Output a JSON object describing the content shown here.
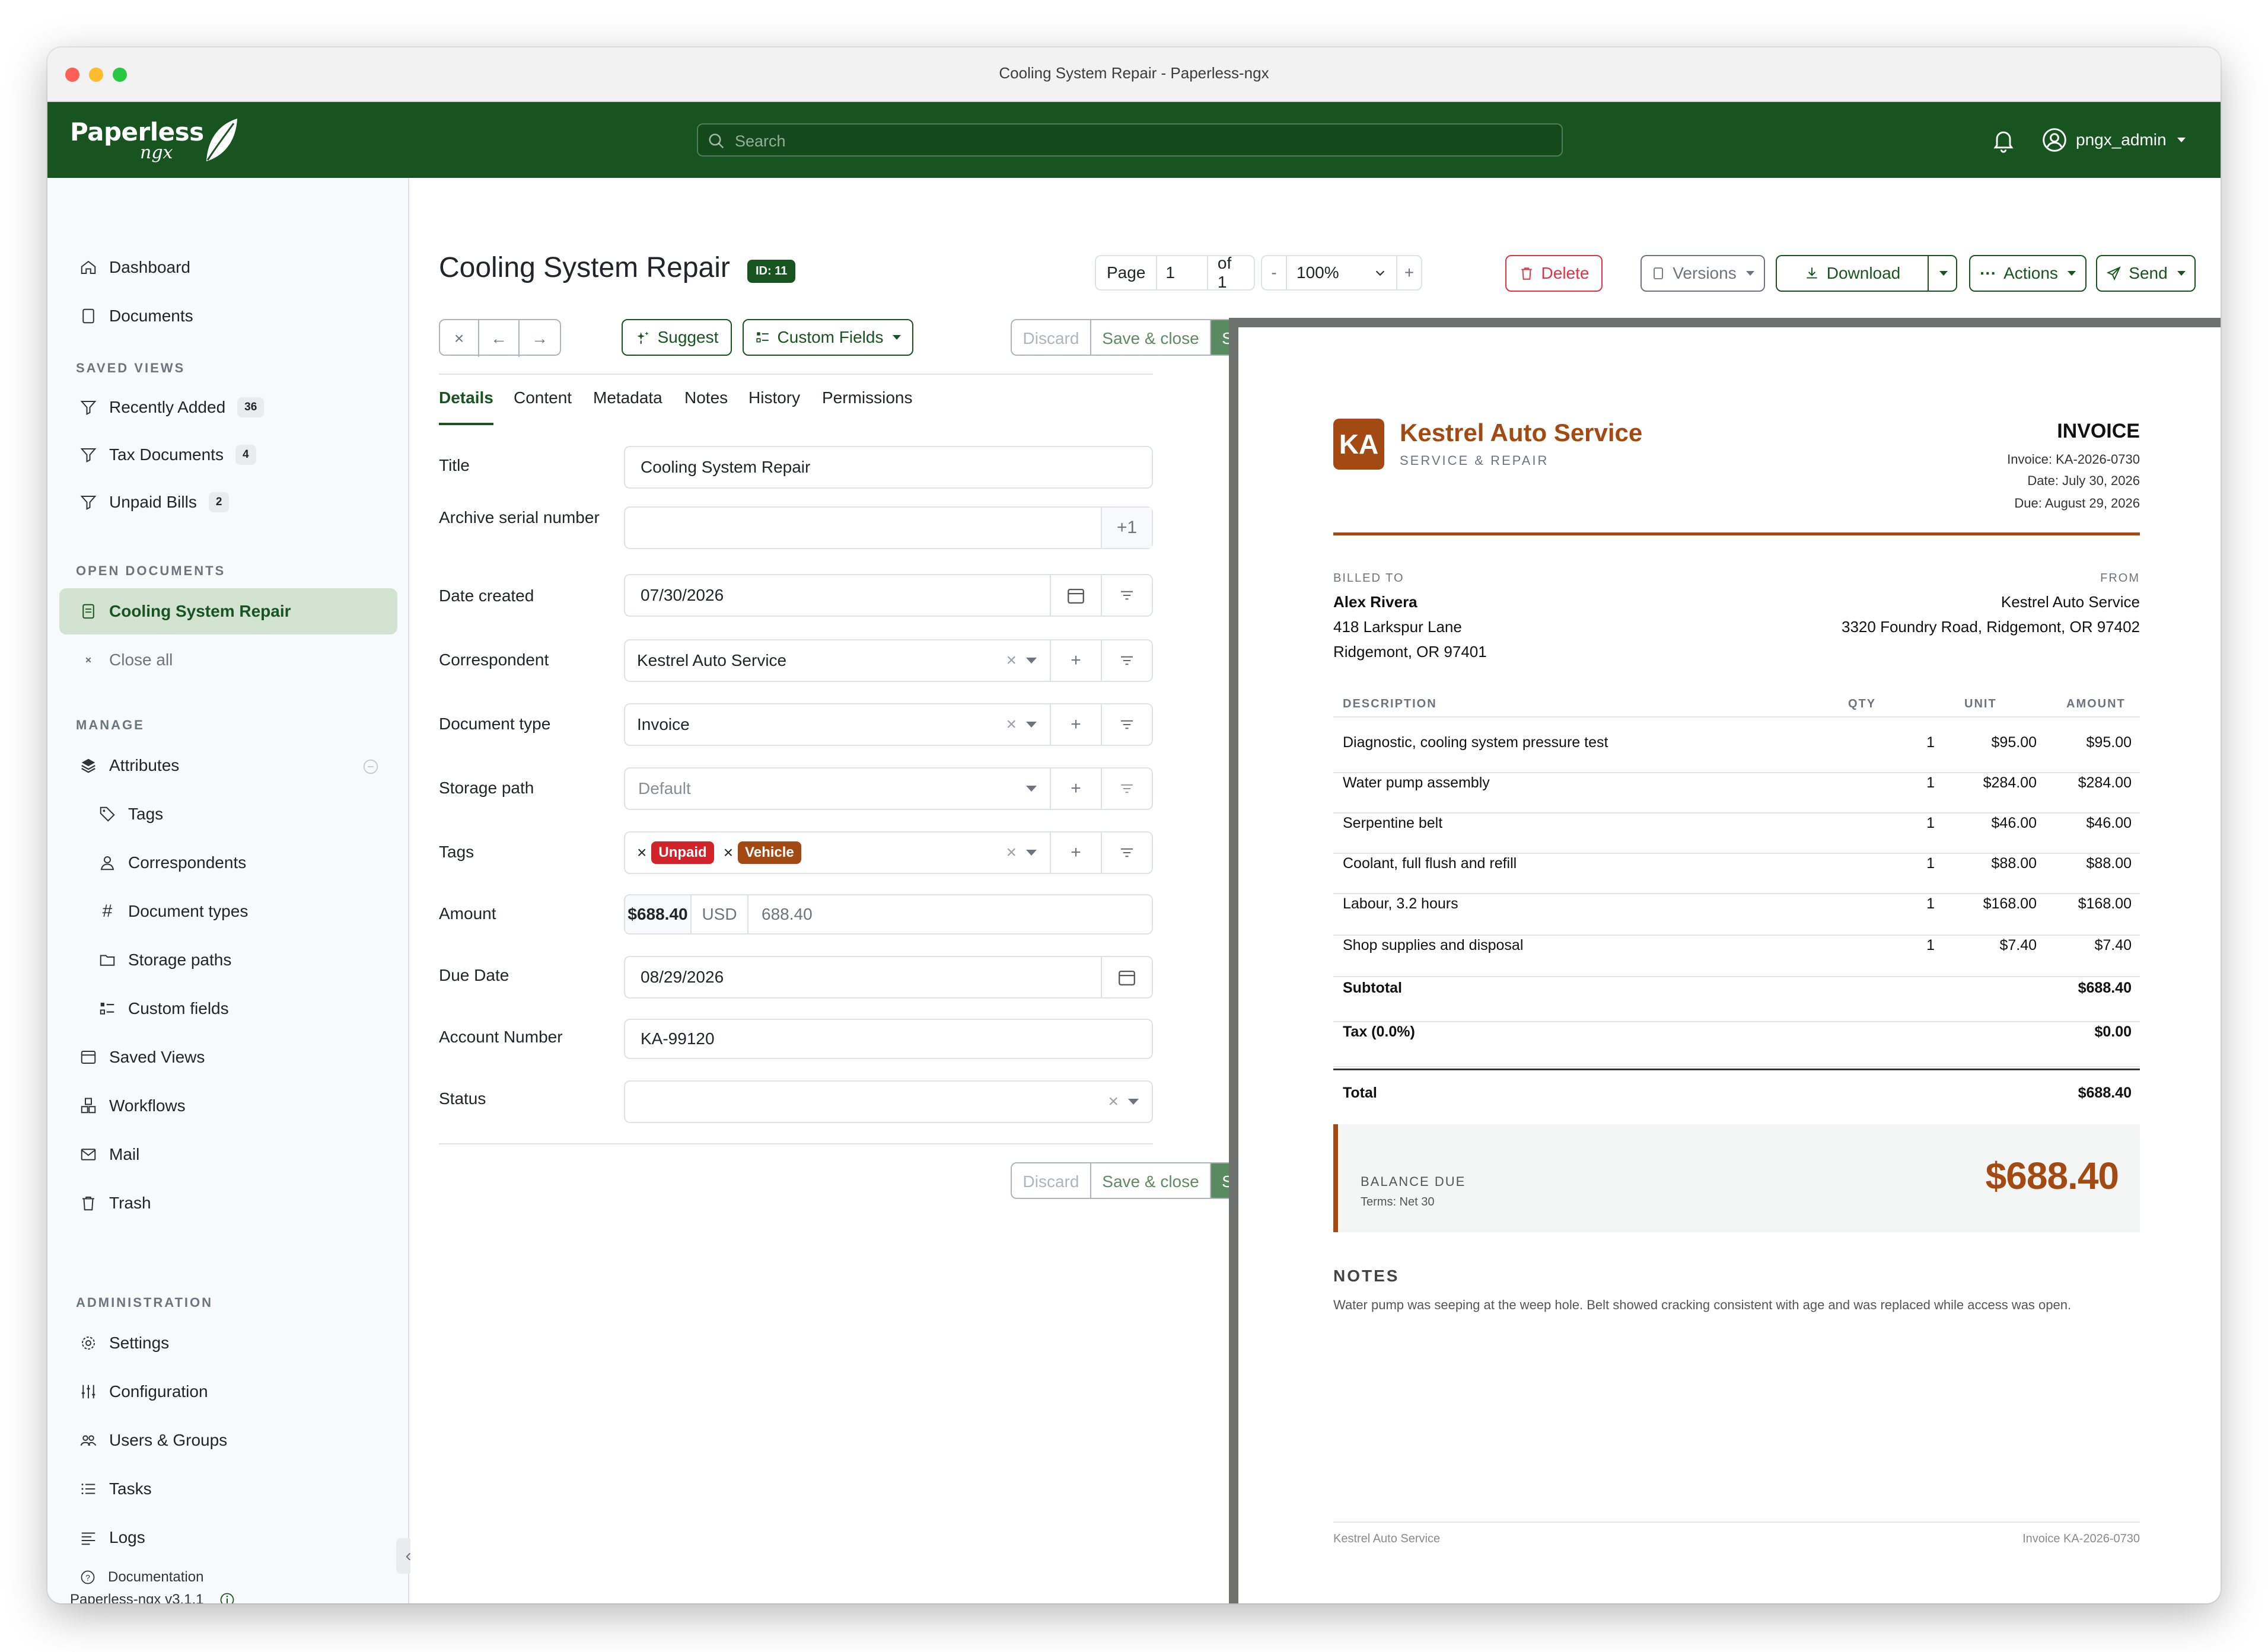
{
  "window": {
    "title": "Cooling System Repair - Paperless-ngx"
  },
  "brand": {
    "name": "Paperless",
    "sub": "ngx"
  },
  "search": {
    "placeholder": "Search"
  },
  "user": {
    "name": "pngx_admin"
  },
  "sidebar": {
    "dashboard": "Dashboard",
    "documents": "Documents",
    "saved_views_header": "SAVED VIEWS",
    "saved_views": [
      {
        "label": "Recently Added",
        "count": "36"
      },
      {
        "label": "Tax Documents",
        "count": "4"
      },
      {
        "label": "Unpaid Bills",
        "count": "2"
      }
    ],
    "open_documents_header": "OPEN DOCUMENTS",
    "open_document": "Cooling System Repair",
    "close_all": "Close all",
    "manage_header": "MANAGE",
    "attributes": "Attributes",
    "attribute_items": [
      "Tags",
      "Correspondents",
      "Document types",
      "Storage paths",
      "Custom fields"
    ],
    "saved_views_link": "Saved Views",
    "workflows": "Workflows",
    "mail": "Mail",
    "trash": "Trash",
    "admin_header": "ADMINISTRATION",
    "settings": "Settings",
    "configuration": "Configuration",
    "users_groups": "Users & Groups",
    "tasks": "Tasks",
    "logs": "Logs",
    "documentation": "Documentation",
    "version": "Paperless-ngx v3.1.1"
  },
  "document": {
    "title": "Cooling System Repair",
    "id_badge": "ID: 11"
  },
  "pager": {
    "page_label": "Page",
    "page": "1",
    "of": "of 1",
    "minus": "-",
    "zoom": "100%",
    "plus": "+"
  },
  "header_actions": {
    "delete": "Delete",
    "versions": "Versions",
    "download": "Download",
    "actions": "Actions",
    "send": "Send"
  },
  "toolbar": {
    "suggest": "Suggest",
    "custom_fields": "Custom Fields",
    "discard": "Discard",
    "save_close": "Save & close",
    "save": "Save"
  },
  "tabs": [
    "Details",
    "Content",
    "Metadata",
    "Notes",
    "History",
    "Permissions"
  ],
  "fields": {
    "title": {
      "label": "Title",
      "value": "Cooling System Repair"
    },
    "asn": {
      "label": "Archive serial number",
      "plus": "+1"
    },
    "date_created": {
      "label": "Date created",
      "value": "07/30/2026"
    },
    "correspondent": {
      "label": "Correspondent",
      "value": "Kestrel Auto Service"
    },
    "document_type": {
      "label": "Document type",
      "value": "Invoice"
    },
    "storage_path": {
      "label": "Storage path",
      "placeholder": "Default"
    },
    "tags": {
      "label": "Tags",
      "items": [
        {
          "name": "Unpaid",
          "color": "#d1232a"
        },
        {
          "name": "Vehicle",
          "color": "#a24a12"
        }
      ]
    },
    "amount": {
      "label": "Amount",
      "display": "$688.40",
      "currency": "USD",
      "value": "688.40"
    },
    "due_date": {
      "label": "Due Date",
      "value": "08/29/2026"
    },
    "account_number": {
      "label": "Account Number",
      "value": "KA-99120"
    },
    "status": {
      "label": "Status"
    }
  },
  "invoice": {
    "logo": "KA",
    "company": "Kestrel Auto Service",
    "company_sub": "SERVICE & REPAIR",
    "heading": "INVOICE",
    "meta": [
      "Invoice: KA-2026-0730",
      "Date: July 30, 2026",
      "Due: August 29, 2026"
    ],
    "billed_to_label": "BILLED TO",
    "billed_to": [
      "Alex Rivera",
      "418 Larkspur Lane",
      "Ridgemont, OR 97401"
    ],
    "from_label": "FROM",
    "from": [
      "Kestrel Auto Service",
      "3320 Foundry Road, Ridgemont, OR 97402"
    ],
    "columns": [
      "DESCRIPTION",
      "QTY",
      "UNIT",
      "AMOUNT"
    ],
    "items": [
      {
        "desc": "Diagnostic, cooling system pressure test",
        "qty": "1",
        "unit": "$95.00",
        "amount": "$95.00"
      },
      {
        "desc": "Water pump assembly",
        "qty": "1",
        "unit": "$284.00",
        "amount": "$284.00"
      },
      {
        "desc": "Serpentine belt",
        "qty": "1",
        "unit": "$46.00",
        "amount": "$46.00"
      },
      {
        "desc": "Coolant, full flush and refill",
        "qty": "1",
        "unit": "$88.00",
        "amount": "$88.00"
      },
      {
        "desc": "Labour, 3.2 hours",
        "qty": "1",
        "unit": "$168.00",
        "amount": "$168.00"
      },
      {
        "desc": "Shop supplies and disposal",
        "qty": "1",
        "unit": "$7.40",
        "amount": "$7.40"
      }
    ],
    "subtotal_label": "Subtotal",
    "subtotal": "$688.40",
    "tax_label": "Tax (0.0%)",
    "tax": "$0.00",
    "total_label": "Total",
    "total": "$688.40",
    "balance_label": "BALANCE DUE",
    "terms": "Terms: Net 30",
    "balance": "$688.40",
    "notes_label": "NOTES",
    "notes": "Water pump was seeping at the weep hole. Belt showed cracking consistent with age and was replaced while access was open.",
    "footer_left": "Kestrel Auto Service",
    "footer_right": "Invoice KA-2026-0730",
    "accent": "#a24a12"
  },
  "colors": {
    "brand": "#17541f",
    "danger": "#dc3545"
  }
}
